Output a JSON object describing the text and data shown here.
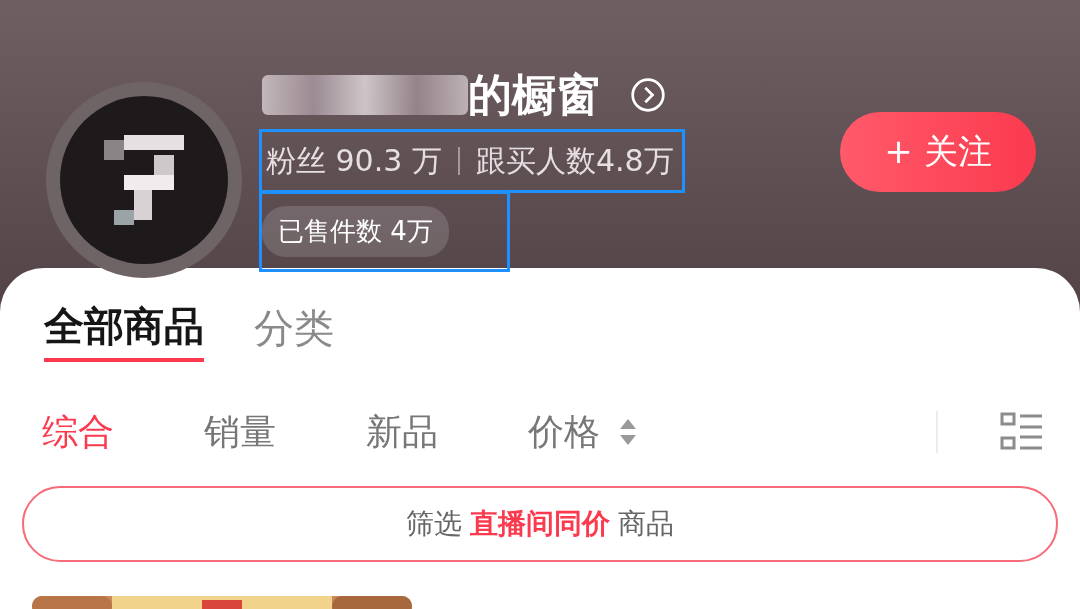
{
  "shop": {
    "title": "的橱窗",
    "followers": "粉丝 90.3 万",
    "buyers": "跟买人数4.8万",
    "sold": "已售件数 4万",
    "follow_button": "+ 关注"
  },
  "tabs": [
    {
      "label": "全部商品",
      "selected": true
    },
    {
      "label": "分类",
      "selected": false
    }
  ],
  "sort_options": [
    {
      "label": "综合",
      "selected": true,
      "kind": "plain"
    },
    {
      "label": "销量",
      "selected": false,
      "kind": "plain"
    },
    {
      "label": "新品",
      "selected": false,
      "kind": "plain"
    },
    {
      "label": "价格",
      "selected": false,
      "kind": "sortable"
    }
  ],
  "filter": {
    "prefix": "筛选",
    "highlight": "直播间同价",
    "suffix": "商品"
  }
}
